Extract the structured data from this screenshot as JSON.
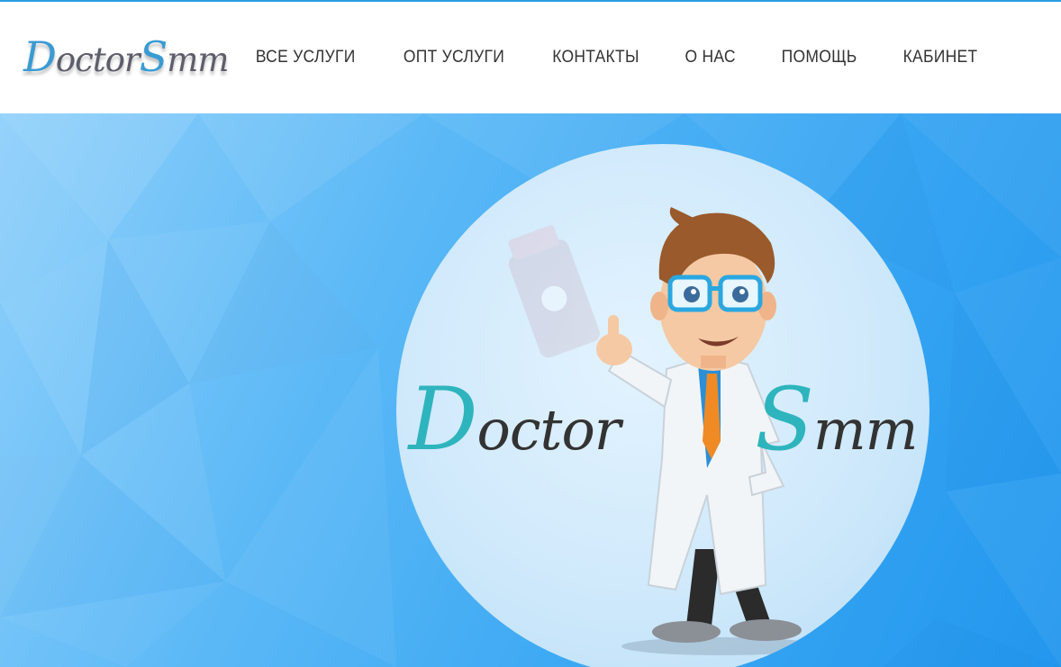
{
  "header": {
    "logo_text_1": "Doctor",
    "logo_text_2": "Smm",
    "nav": [
      {
        "label": "ВСЕ УСЛУГИ"
      },
      {
        "label": "ОПТ УСЛУГИ"
      },
      {
        "label": "КОНТАКТЫ"
      },
      {
        "label": "О НАС"
      },
      {
        "label": "ПОМОЩЬ"
      },
      {
        "label": "КАБИНЕТ"
      }
    ]
  },
  "hero": {
    "title_word_1": "Doctor",
    "title_word_2": "Smm",
    "mascot_icon": "doctor-mascot-icon",
    "bottle_icon": "medicine-bottle-icon"
  },
  "colors": {
    "accent": "#2a9fe0",
    "hero_blue": "#3aa7f3",
    "logo_teal": "#2eb4bd"
  }
}
